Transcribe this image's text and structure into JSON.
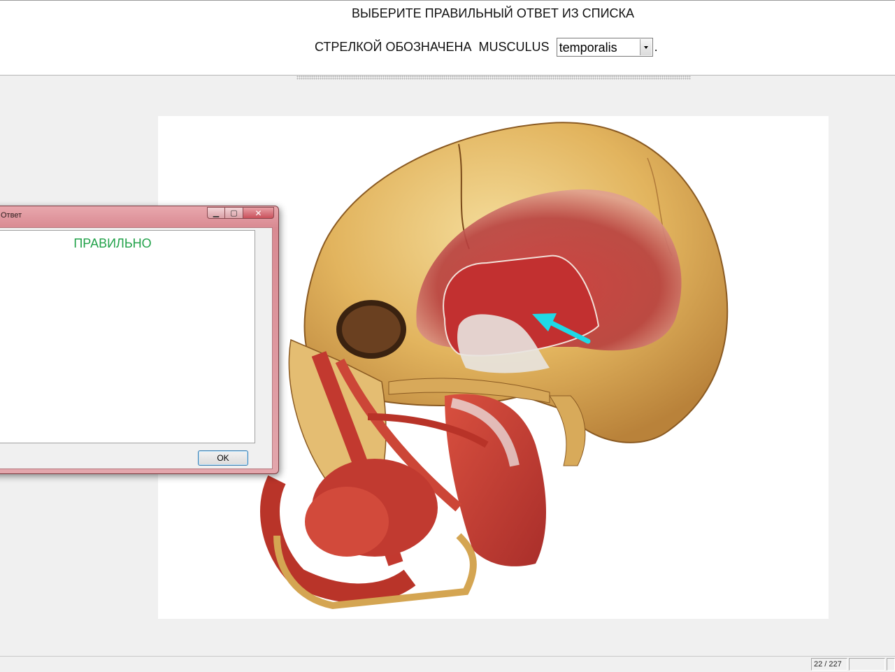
{
  "header": {
    "instruction": "ВЫБЕРИТЕ ПРАВИЛЬНЫЙ ОТВЕТ ИЗ СПИСКА",
    "question_prefix": "СТРЕЛКОЙ ОБОЗНАЧЕНА",
    "question_term": "MUSCULUS",
    "answer_select": {
      "selected": "temporalis"
    },
    "trailing_punct": "."
  },
  "image": {
    "description_icon": "skull-muscles-illustration",
    "arrow_color": "#1fd9e6"
  },
  "dialog": {
    "title": "Ответ",
    "message": "ПРАВИЛЬНО",
    "message_color": "#22a24a",
    "ok_label": "OK",
    "buttons": {
      "minimize_icon": "minimize-icon",
      "maximize_icon": "maximize-icon",
      "close_icon": "close-icon"
    }
  },
  "statusbar": {
    "page_counter": "22 / 227"
  }
}
